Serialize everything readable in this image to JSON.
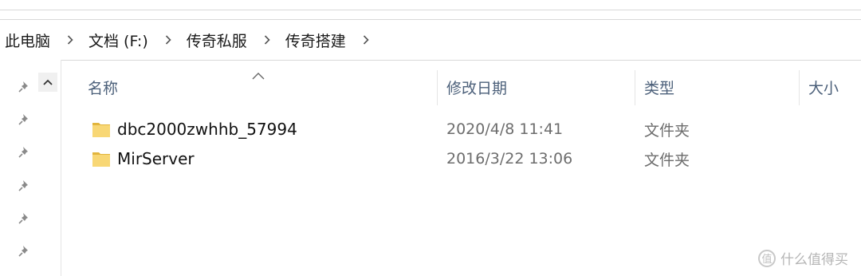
{
  "breadcrumb": [
    "此电脑",
    "文档 (F:)",
    "传奇私服",
    "传奇搭建"
  ],
  "columns": {
    "name": "名称",
    "modified": "修改日期",
    "type": "类型",
    "size": "大小"
  },
  "files": [
    {
      "name": "dbc2000zwhhb_57994",
      "modified": "2020/4/8 11:41",
      "type": "文件夹"
    },
    {
      "name": "MirServer",
      "modified": "2016/3/22 13:06",
      "type": "文件夹"
    }
  ],
  "watermark": "什么值得买",
  "icons": {
    "pin": "pin-icon",
    "folder": "folder-icon",
    "chevron": "chevron-right-icon",
    "sort": "sort-ascending-icon",
    "scroll_up": "scroll-up-icon"
  },
  "colors": {
    "header_text": "#4c607a",
    "folder_fill": "#f8d775",
    "folder_dark": "#e2b53d",
    "secondary_text": "#6d6d6d"
  }
}
